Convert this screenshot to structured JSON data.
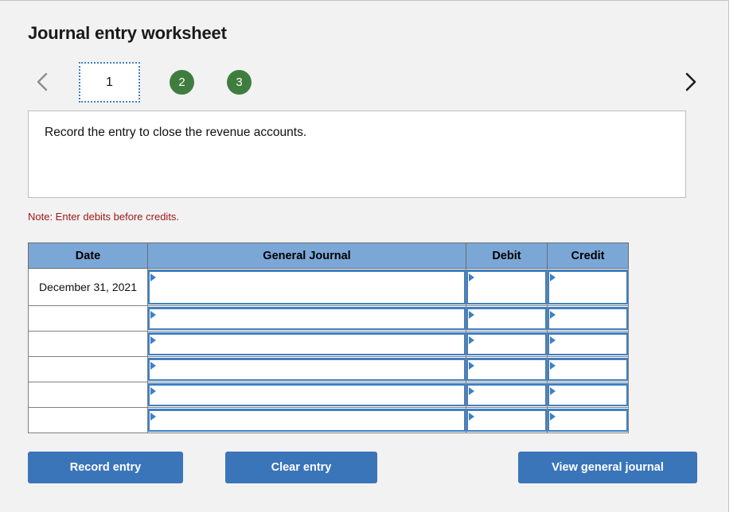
{
  "worksheet": {
    "title": "Journal entry worksheet",
    "instruction": "Record the entry to close the revenue accounts.",
    "note": "Note: Enter debits before credits."
  },
  "pager": {
    "prev_icon": "chevron-left-icon",
    "next_icon": "chevron-right-icon",
    "active_page": "1",
    "pages": [
      "1",
      "2",
      "3"
    ],
    "page_2": "2",
    "page_3": "3",
    "active_color": "#3f7fc4",
    "circle_color": "#3f7d3f"
  },
  "table": {
    "headers": {
      "date": "Date",
      "general_journal": "General Journal",
      "debit": "Debit",
      "credit": "Credit"
    },
    "header_bg": "#7ba7d7",
    "rows": [
      {
        "date": "December 31, 2021",
        "general_journal": "",
        "debit": "",
        "credit": ""
      },
      {
        "date": "",
        "general_journal": "",
        "debit": "",
        "credit": ""
      },
      {
        "date": "",
        "general_journal": "",
        "debit": "",
        "credit": ""
      },
      {
        "date": "",
        "general_journal": "",
        "debit": "",
        "credit": ""
      },
      {
        "date": "",
        "general_journal": "",
        "debit": "",
        "credit": ""
      },
      {
        "date": "",
        "general_journal": "",
        "debit": "",
        "credit": ""
      }
    ]
  },
  "buttons": {
    "record": "Record entry",
    "clear": "Clear entry",
    "view": "View general journal",
    "color": "#3a75ba"
  }
}
